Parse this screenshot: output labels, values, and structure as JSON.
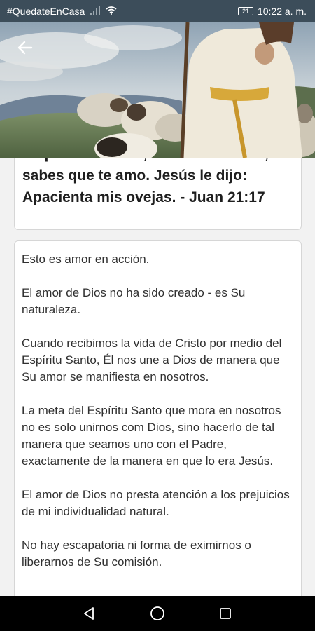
{
  "status_bar": {
    "hashtag": "#QuedateEnCasa",
    "battery": "21",
    "time": "10:22 a. m."
  },
  "header": {
    "back_icon": "arrow-left-icon",
    "image": "shepherd-with-sheep"
  },
  "verse": {
    "text": "respondió: Señor, tú lo sabes todo; tú sabes que te amo. Jesús le dijo: Apacienta mis ovejas. - Juan 21:17"
  },
  "devotional": {
    "paragraphs": [
      "Esto es amor en acción.",
      "El amor de Dios no ha sido creado - es Su naturaleza.",
      "Cuando recibimos la vida de Cristo por medio del Espíritu Santo, Él nos une a Dios de manera que Su amor se manifiesta en nosotros.",
      "La meta del Espíritu Santo que mora en nosotros no es solo unirnos com Dios, sino hacerlo de tal manera que seamos uno con el Padre, exactamente de la manera en que lo era Jesús.",
      "El amor de Dios no presta atención a los prejuicios de mi individualidad natural.",
      "No hay escapatoria ni forma de eximirnos o liberarnos de Su comisión."
    ]
  },
  "nav_bar": {
    "back": "triangle-back-icon",
    "home": "circle-home-icon",
    "recents": "square-recents-icon"
  }
}
